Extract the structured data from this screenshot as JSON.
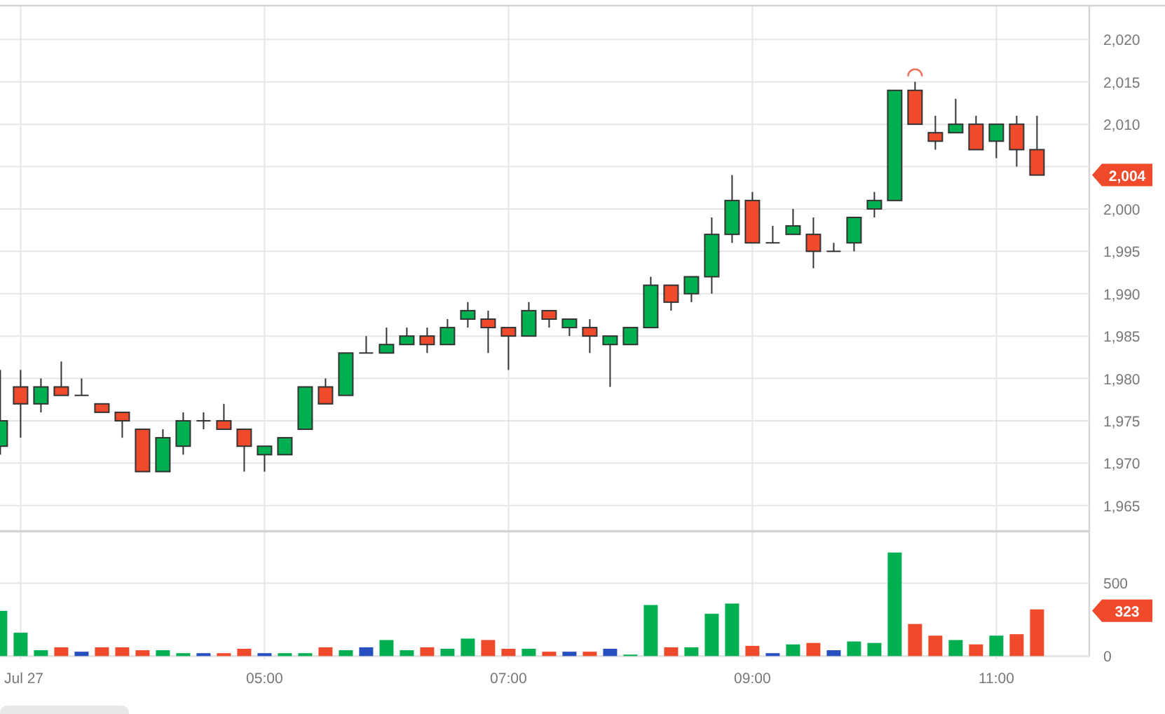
{
  "price_chart": {
    "last_price": "2,004",
    "chart_data": {
      "type": "candlestick",
      "grid": true,
      "ylim": [
        1962,
        2024
      ],
      "yticks": [
        {
          "value": 2020,
          "label": "2,020"
        },
        {
          "value": 2015,
          "label": "2,015"
        },
        {
          "value": 2010,
          "label": "2,010"
        },
        {
          "value": 2000,
          "label": "2,000"
        },
        {
          "value": 1995,
          "label": "1,995"
        },
        {
          "value": 1990,
          "label": "1,990"
        },
        {
          "value": 1985,
          "label": "1,985"
        },
        {
          "value": 1980,
          "label": "1,980"
        },
        {
          "value": 1975,
          "label": "1,975"
        },
        {
          "value": 1970,
          "label": "1,970"
        },
        {
          "value": 1965,
          "label": "1,965"
        }
      ],
      "ohlc": [
        [
          1972,
          1981,
          1971,
          1975
        ],
        [
          1979,
          1981,
          1973,
          1977
        ],
        [
          1977,
          1980,
          1976,
          1979
        ],
        [
          1979,
          1982,
          1978,
          1978
        ],
        [
          1978,
          1980,
          1978,
          1978
        ],
        [
          1977,
          1977,
          1976,
          1976
        ],
        [
          1976,
          1976,
          1973,
          1975
        ],
        [
          1974,
          1974,
          1969,
          1969
        ],
        [
          1969,
          1974,
          1969,
          1973
        ],
        [
          1972,
          1976,
          1971,
          1975
        ],
        [
          1975,
          1976,
          1974,
          1975
        ],
        [
          1975,
          1977,
          1974,
          1974
        ],
        [
          1974,
          1974,
          1969,
          1972
        ],
        [
          1971,
          1972,
          1969,
          1972
        ],
        [
          1971,
          1973,
          1971,
          1973
        ],
        [
          1974,
          1979,
          1974,
          1979
        ],
        [
          1979,
          1980,
          1977,
          1977
        ],
        [
          1978,
          1983,
          1978,
          1983
        ],
        [
          1983,
          1985,
          1983,
          1983
        ],
        [
          1983,
          1986,
          1983,
          1984
        ],
        [
          1984,
          1986,
          1984,
          1985
        ],
        [
          1985,
          1986,
          1983,
          1984
        ],
        [
          1984,
          1987,
          1984,
          1986
        ],
        [
          1987,
          1989,
          1986,
          1988
        ],
        [
          1987,
          1988,
          1983,
          1986
        ],
        [
          1986,
          1986,
          1981,
          1985
        ],
        [
          1985,
          1989,
          1985,
          1988
        ],
        [
          1988,
          1988,
          1986,
          1987
        ],
        [
          1986,
          1987,
          1985,
          1987
        ],
        [
          1986,
          1987,
          1983,
          1985
        ],
        [
          1984,
          1985,
          1979,
          1985
        ],
        [
          1984,
          1986,
          1984,
          1986
        ],
        [
          1986,
          1992,
          1986,
          1991
        ],
        [
          1991,
          1991,
          1988,
          1989
        ],
        [
          1990,
          1992,
          1989,
          1992
        ],
        [
          1992,
          1999,
          1990,
          1997
        ],
        [
          1997,
          2004,
          1996,
          2001
        ],
        [
          2001,
          2002,
          1996,
          1996
        ],
        [
          1996,
          1998,
          1996,
          1996
        ],
        [
          1997,
          2000,
          1997,
          1998
        ],
        [
          1997,
          1999,
          1993,
          1995
        ],
        [
          1995,
          1996,
          1995,
          1995
        ],
        [
          1996,
          1999,
          1995,
          1999
        ],
        [
          2000,
          2002,
          1999,
          2001
        ],
        [
          2001,
          2014,
          2001,
          2014
        ],
        [
          2014,
          2015,
          2010,
          2010
        ],
        [
          2009,
          2011,
          2007,
          2008
        ],
        [
          2009,
          2013,
          2009,
          2010
        ],
        [
          2010,
          2011,
          2007,
          2007
        ],
        [
          2008,
          2010,
          2006,
          2010
        ],
        [
          2010,
          2011,
          2005,
          2007
        ],
        [
          2007,
          2011,
          2004,
          2004
        ]
      ]
    }
  },
  "volume_chart": {
    "last_volume": "323",
    "chart_data": {
      "type": "bar",
      "grid": true,
      "ylim": [
        0,
        853
      ],
      "categories": [
        null,
        "Jul 27",
        null,
        null,
        null,
        null,
        null,
        null,
        null,
        null,
        null,
        null,
        null,
        "05:00",
        null,
        null,
        null,
        null,
        null,
        null,
        null,
        null,
        null,
        null,
        null,
        "07:00",
        null,
        null,
        null,
        null,
        null,
        null,
        null,
        null,
        null,
        null,
        null,
        "09:00",
        null,
        null,
        null,
        null,
        null,
        null,
        null,
        null,
        null,
        null,
        null,
        "11:00",
        null,
        null
      ],
      "yticks": [
        0,
        500
      ],
      "series": [
        {
          "color": "#00b050",
          "values": [
            310,
            160,
            40,
            null,
            null,
            null,
            null,
            null,
            40,
            20,
            null,
            null,
            null,
            null,
            20,
            20,
            null,
            40,
            null,
            110,
            40,
            null,
            50,
            120,
            null,
            null,
            50,
            null,
            null,
            null,
            null,
            10,
            350,
            null,
            60,
            290,
            360,
            null,
            null,
            80,
            null,
            null,
            100,
            90,
            710,
            null,
            null,
            110,
            null,
            140,
            null,
            null
          ]
        },
        {
          "color": "#f04a2c",
          "values": [
            null,
            null,
            null,
            60,
            null,
            60,
            60,
            40,
            null,
            null,
            null,
            20,
            50,
            null,
            null,
            null,
            60,
            null,
            null,
            null,
            null,
            60,
            null,
            null,
            110,
            50,
            null,
            30,
            null,
            30,
            null,
            null,
            null,
            60,
            null,
            null,
            null,
            70,
            null,
            null,
            90,
            null,
            null,
            null,
            null,
            220,
            140,
            null,
            80,
            null,
            150,
            320
          ]
        },
        {
          "color": "#2650c0",
          "values": [
            null,
            null,
            null,
            null,
            30,
            null,
            null,
            null,
            null,
            null,
            20,
            null,
            null,
            20,
            null,
            null,
            null,
            null,
            60,
            null,
            null,
            null,
            null,
            null,
            null,
            null,
            null,
            null,
            30,
            null,
            50,
            null,
            null,
            null,
            null,
            null,
            null,
            null,
            20,
            null,
            null,
            40,
            null,
            null,
            null,
            null,
            null,
            null,
            null,
            null,
            null,
            null
          ]
        }
      ]
    }
  }
}
